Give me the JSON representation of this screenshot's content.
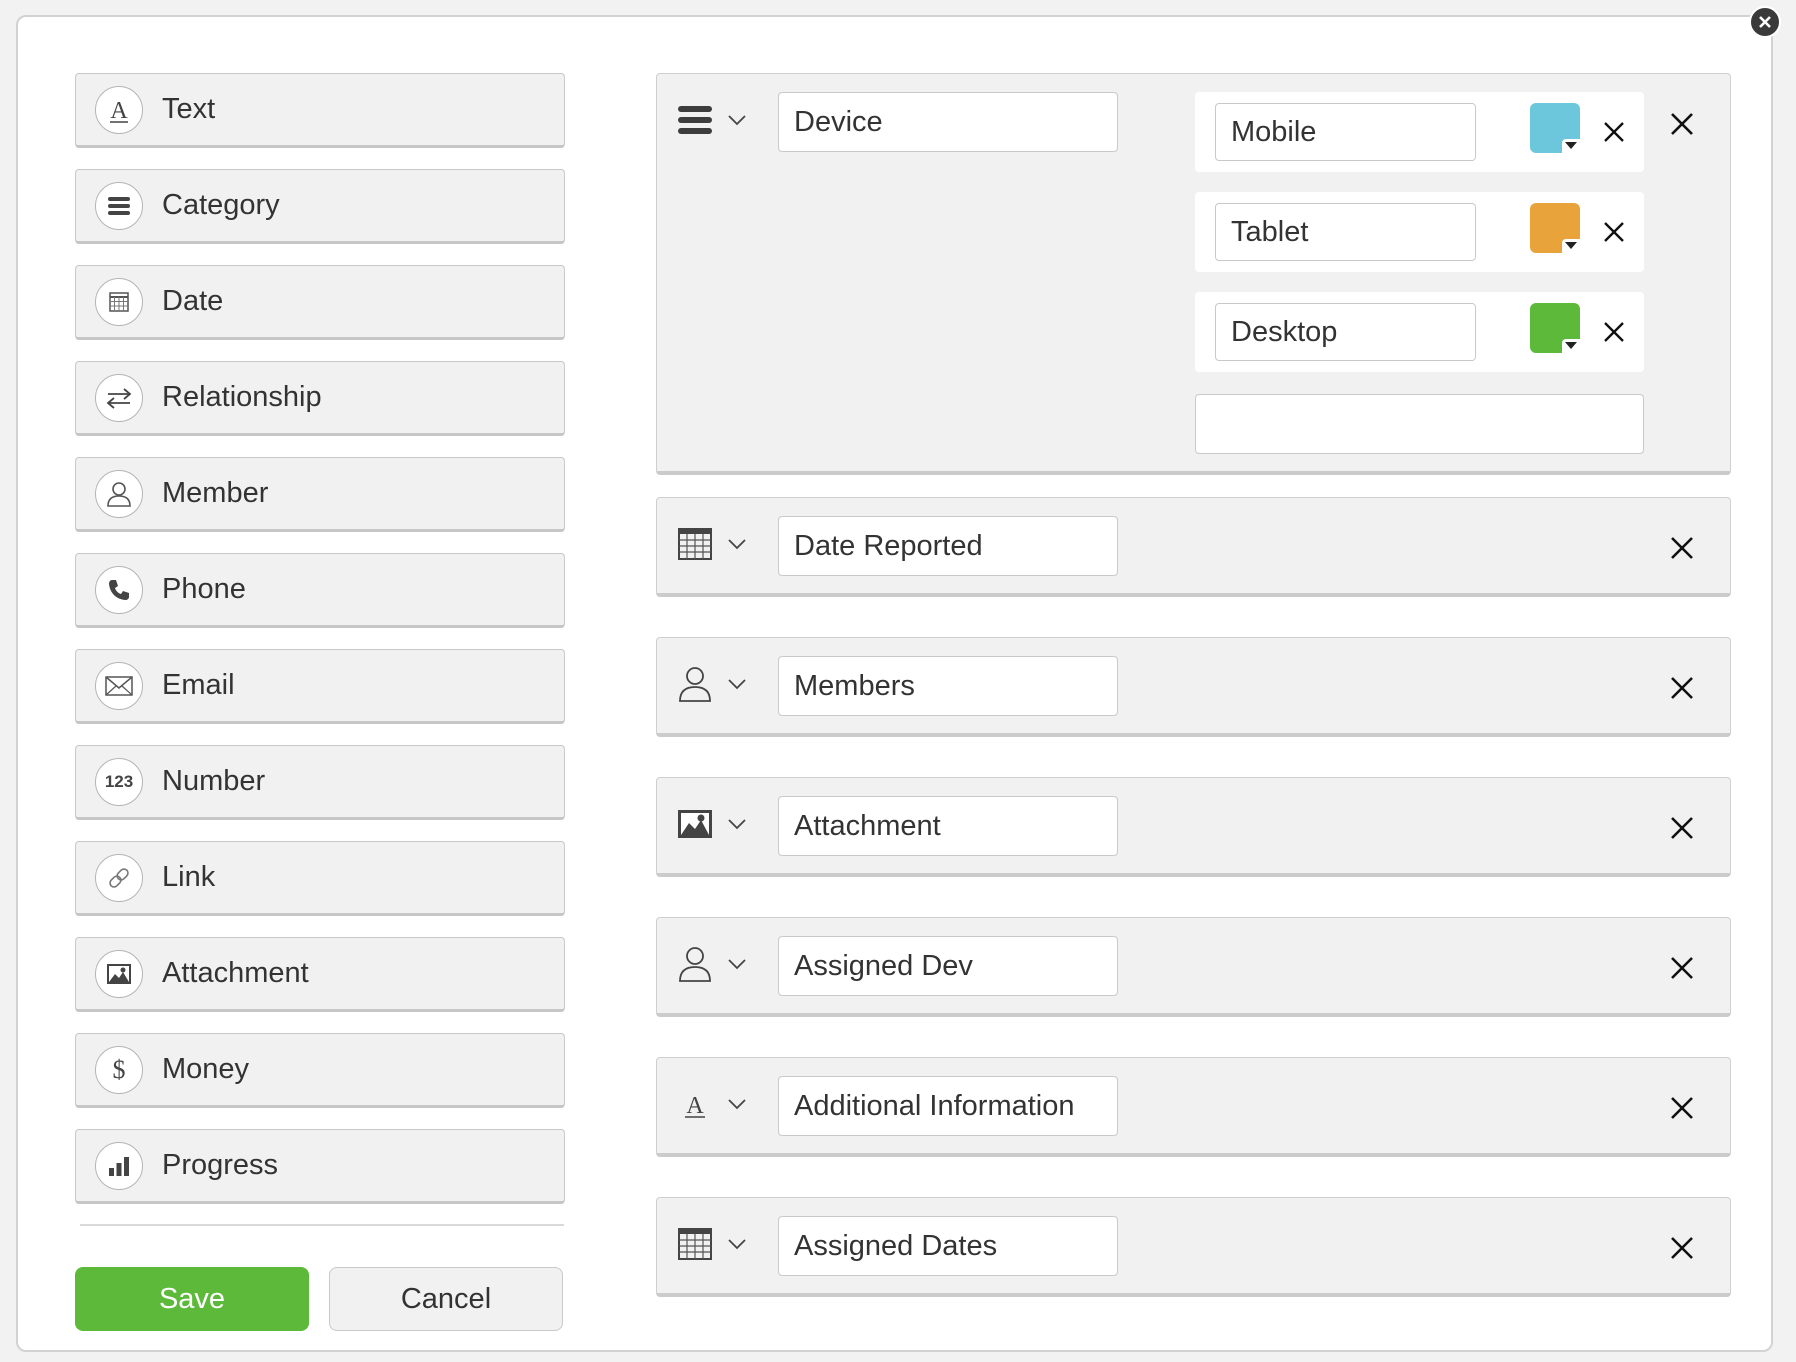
{
  "palette": {
    "items": [
      {
        "label": "Text",
        "icon": "text-icon"
      },
      {
        "label": "Category",
        "icon": "category-icon"
      },
      {
        "label": "Date",
        "icon": "calendar-icon"
      },
      {
        "label": "Relationship",
        "icon": "relationship-icon"
      },
      {
        "label": "Member",
        "icon": "person-icon"
      },
      {
        "label": "Phone",
        "icon": "phone-icon"
      },
      {
        "label": "Email",
        "icon": "envelope-icon"
      },
      {
        "label": "Number",
        "icon": "number-icon",
        "glyph": "123"
      },
      {
        "label": "Link",
        "icon": "link-icon"
      },
      {
        "label": "Attachment",
        "icon": "image-icon"
      },
      {
        "label": "Money",
        "icon": "dollar-icon",
        "glyph": "$"
      },
      {
        "label": "Progress",
        "icon": "progress-bars-icon"
      }
    ]
  },
  "actions": {
    "save_label": "Save",
    "cancel_label": "Cancel",
    "save_color": "#5db93a"
  },
  "fields": {
    "device": {
      "name": "Device",
      "type_icon": "category-icon",
      "options": [
        {
          "label": "Mobile",
          "color": "#6cc7dc"
        },
        {
          "label": "Tablet",
          "color": "#e8a43a"
        },
        {
          "label": "Desktop",
          "color": "#5db93a"
        }
      ],
      "new_option_value": ""
    },
    "rows": [
      {
        "name": "Date Reported",
        "type_icon": "calendar-icon"
      },
      {
        "name": "Members",
        "type_icon": "person-icon"
      },
      {
        "name": "Attachment",
        "type_icon": "image-icon"
      },
      {
        "name": "Assigned Dev",
        "type_icon": "person-icon"
      },
      {
        "name": "Additional Information",
        "type_icon": "text-icon"
      },
      {
        "name": "Assigned Dates",
        "type_icon": "calendar-icon"
      }
    ]
  }
}
